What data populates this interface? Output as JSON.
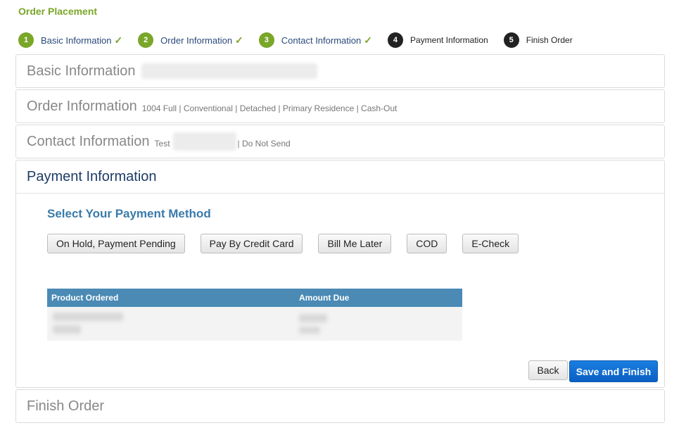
{
  "page_title": "Order Placement",
  "steps": [
    {
      "num": "1",
      "label": "Basic Information",
      "status": "done"
    },
    {
      "num": "2",
      "label": "Order Information",
      "status": "done"
    },
    {
      "num": "3",
      "label": "Contact Information",
      "status": "done"
    },
    {
      "num": "4",
      "label": "Payment Information",
      "status": "current"
    },
    {
      "num": "5",
      "label": "Finish Order",
      "status": "todo"
    }
  ],
  "check_glyph": "✓",
  "panels": {
    "basic": {
      "title": "Basic Information"
    },
    "order": {
      "title": "Order Information",
      "summary": "1004 Full | Conventional | Detached | Primary Residence | Cash-Out"
    },
    "contact": {
      "title": "Contact Information",
      "summary_prefix": "Test",
      "summary_suffix": "| Do Not Send"
    },
    "payment": {
      "title": "Payment Information",
      "heading": "Select Your Payment Method",
      "methods": [
        "On Hold, Payment Pending",
        "Pay By Credit Card",
        "Bill Me Later",
        "COD",
        "E-Check"
      ],
      "table": {
        "columns": [
          "Product Ordered",
          "Amount Due"
        ]
      },
      "back_label": "Back",
      "save_label": "Save and Finish"
    },
    "finish": {
      "title": "Finish Order"
    }
  },
  "colors": {
    "accent_green": "#7aa629",
    "heading_blue": "#3a7aaa",
    "table_header": "#4a8ab5",
    "primary_button": "#0b5fc4"
  }
}
